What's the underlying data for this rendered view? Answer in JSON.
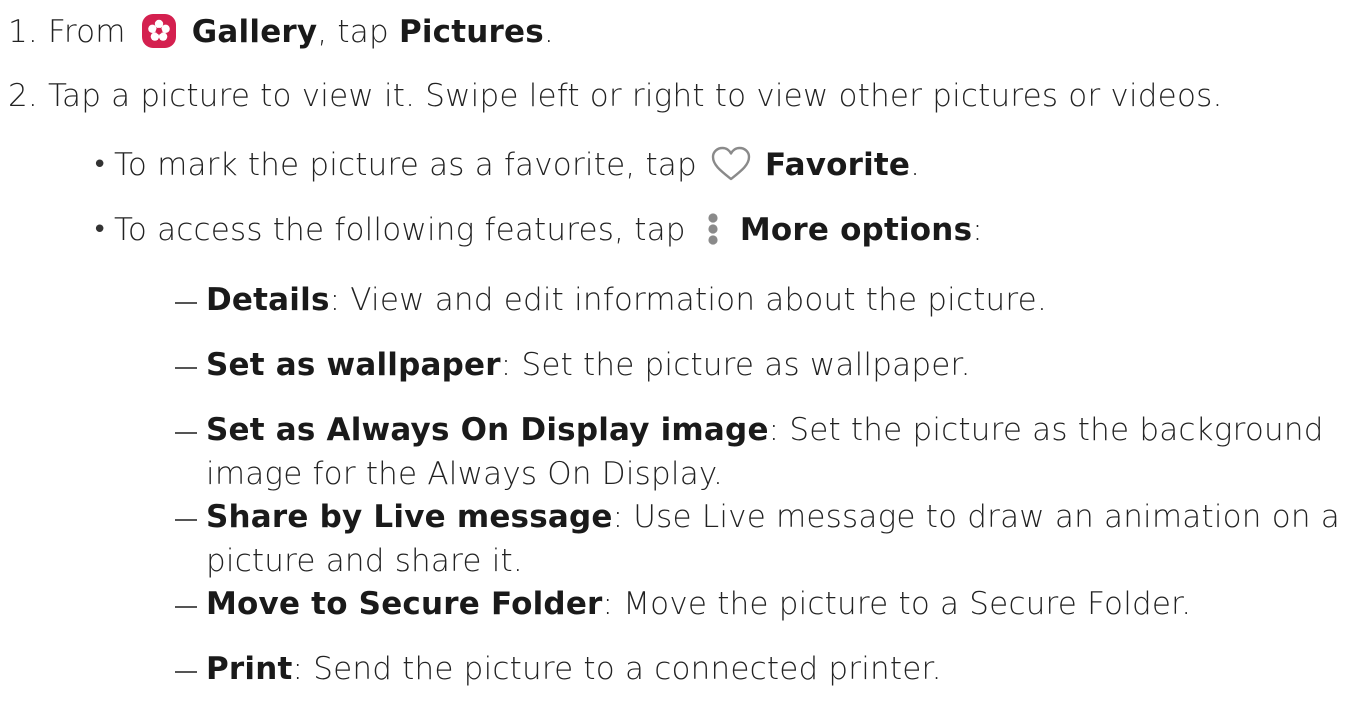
{
  "steps": {
    "step1": {
      "number": "1.",
      "prefix": "From",
      "gallery_label": "Gallery",
      "middle": ", tap",
      "pictures_label": "Pictures",
      "suffix": "."
    },
    "step2": {
      "number": "2.",
      "text": "Tap a picture to view it. Swipe left or right to view other pictures or videos."
    }
  },
  "bullets": {
    "favorite": {
      "prefix": "To mark the picture as a favorite, tap",
      "label": "Favorite",
      "suffix": "."
    },
    "more_options": {
      "prefix": "To access the following features, tap",
      "label": "More options",
      "suffix": ":"
    }
  },
  "features": [
    {
      "name": "Details",
      "desc": ": View and edit information about the picture."
    },
    {
      "name": "Set as wallpaper",
      "desc": ": Set the picture as wallpaper."
    },
    {
      "name": "Set as Always On Display image",
      "desc": ": Set the picture as the background",
      "desc_cont": "image for the Always On Display."
    },
    {
      "name": "Share by Live message",
      "desc": ": Use Live message to draw an animation on a",
      "desc_cont": "picture and share it."
    },
    {
      "name": "Move to Secure Folder",
      "desc": ": Move the picture to a Secure Folder."
    },
    {
      "name": "Print",
      "desc": ": Send the picture to a connected printer."
    }
  ],
  "icons": {
    "gallery": "gallery-icon",
    "favorite": "heart-outline-icon",
    "more": "more-vertical-icon"
  },
  "colors": {
    "gallery_bg": "#d4204f",
    "icon_gray": "#8a8a8a",
    "text": "#222222"
  }
}
